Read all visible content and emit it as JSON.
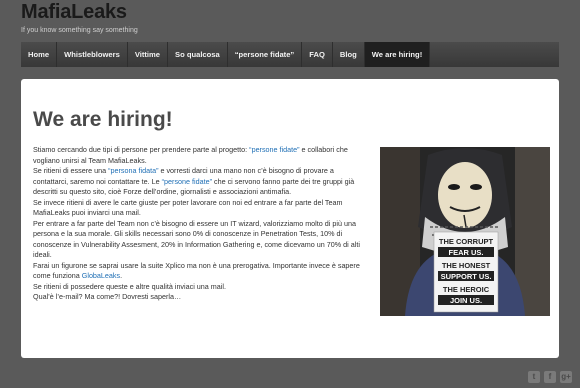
{
  "site": {
    "title": "MafiaLeaks",
    "tagline": "If you know something say something"
  },
  "nav": {
    "items": [
      {
        "label": "Home"
      },
      {
        "label": "Whistleblowers"
      },
      {
        "label": "Vittime"
      },
      {
        "label": "So qualcosa"
      },
      {
        "label": "“persone fidate”"
      },
      {
        "label": "FAQ"
      },
      {
        "label": "Blog"
      },
      {
        "label": "We are hiring!",
        "active": true
      }
    ]
  },
  "page": {
    "heading": "We are hiring!",
    "p1": {
      "a": "Stiamo cercando due tipi di persone per prendere parte al progetto: ",
      "link": "“persone fidate”",
      "b": " e collabori che vogliano unirsi al Team MafiaLeaks."
    },
    "p2": {
      "a": "Se ritieni di essere una ",
      "link1": "“persona fidata”",
      "b": " e vorresti darci una mano non c’è bisogno di provare a contattarci, saremo noi contattare te. Le ",
      "link2": "“persone fidate”",
      "c": " che ci servono fanno parte dei tre gruppi già descritti su questo sito, cioè Forze dell’ordine, giornalisti e associazioni antimafia."
    },
    "p3": "Se invece ritieni di avere le carte giuste per poter lavorare con noi ed entrare a far parte del Team MafiaLeaks puoi inviarci una mail.",
    "p4": "Per entrare a far parte del Team non c’è bisogno di essere un IT wizard, valorizziamo molto di più una persona e la sua morale. Gli skills necessari sono 0% di conoscenze in Penetration Tests, 10% di conoscenze in Vulnerability Assesment, 20% in Information Gathering e, come dicevamo un 70% di alti ideali.",
    "p5": {
      "a": "Farai un figurone se saprai usare la suite Xplico ma non è una prerogativa. Importante invece è sapere come funziona ",
      "link": "GlobaLeaks",
      "b": "."
    },
    "p6": "Se ritieni di possedere queste e altre qualità inviaci una mail.",
    "p7": "Qual’è l’e-mail? Ma come?! Dovresti saperla…",
    "sign_lines": [
      "THE CORRUPT",
      "FEAR US.",
      "THE HONEST",
      "SUPPORT US.",
      "THE HEROIC",
      "JOIN US."
    ]
  },
  "footer": {
    "icons": [
      "twitter-icon",
      "facebook-icon",
      "google-plus-icon"
    ],
    "glyphs": [
      "t",
      "f",
      "g+"
    ]
  },
  "colors": {
    "background": "#5a5a5a",
    "link": "#1f6fb5",
    "nav_active": "#1f1f1f"
  }
}
